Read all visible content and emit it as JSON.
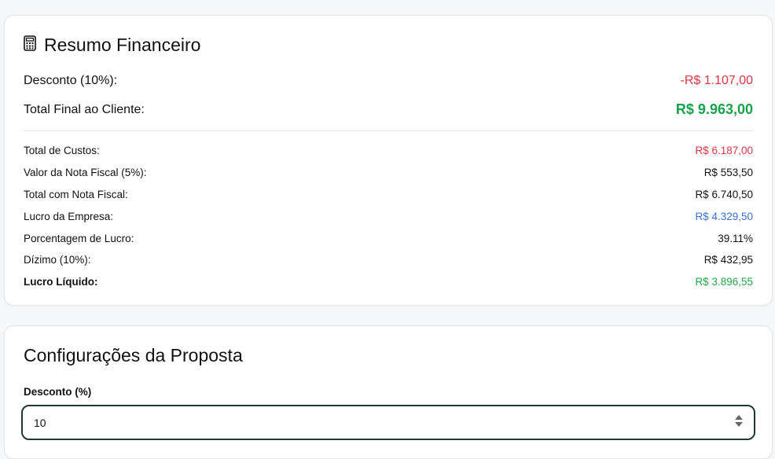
{
  "summary": {
    "title": "Resumo Financeiro",
    "icon": "calculator-icon",
    "discount_label": "Desconto (10%):",
    "discount_value": "-R$ 1.107,00",
    "total_label": "Total Final ao Cliente:",
    "total_value": "R$ 9.963,00",
    "details": [
      {
        "label": "Total de Custos:",
        "value": "R$ 6.187,00",
        "tone": "red"
      },
      {
        "label": "Valor da Nota Fiscal (5%):",
        "value": "R$ 553,50",
        "tone": "default"
      },
      {
        "label": "Total com Nota Fiscal:",
        "value": "R$ 6.740,50",
        "tone": "default"
      },
      {
        "label": "Lucro da Empresa:",
        "value": "R$ 4.329,50",
        "tone": "blue"
      },
      {
        "label": "Porcentagem de Lucro:",
        "value": "39.11%",
        "tone": "default"
      },
      {
        "label": "Dízimo (10%):",
        "value": "R$ 432,95",
        "tone": "default"
      },
      {
        "label": "Lucro Líquido:",
        "value": "R$ 3.896,55",
        "tone": "green"
      }
    ]
  },
  "config": {
    "title": "Configurações da Proposta",
    "discount_field_label": "Desconto (%)",
    "discount_field_value": "10"
  },
  "colors": {
    "negative": "#dc3545",
    "positive": "#16a34a",
    "info": "#3b6fd8",
    "focus_border": "#1f3a2a"
  }
}
